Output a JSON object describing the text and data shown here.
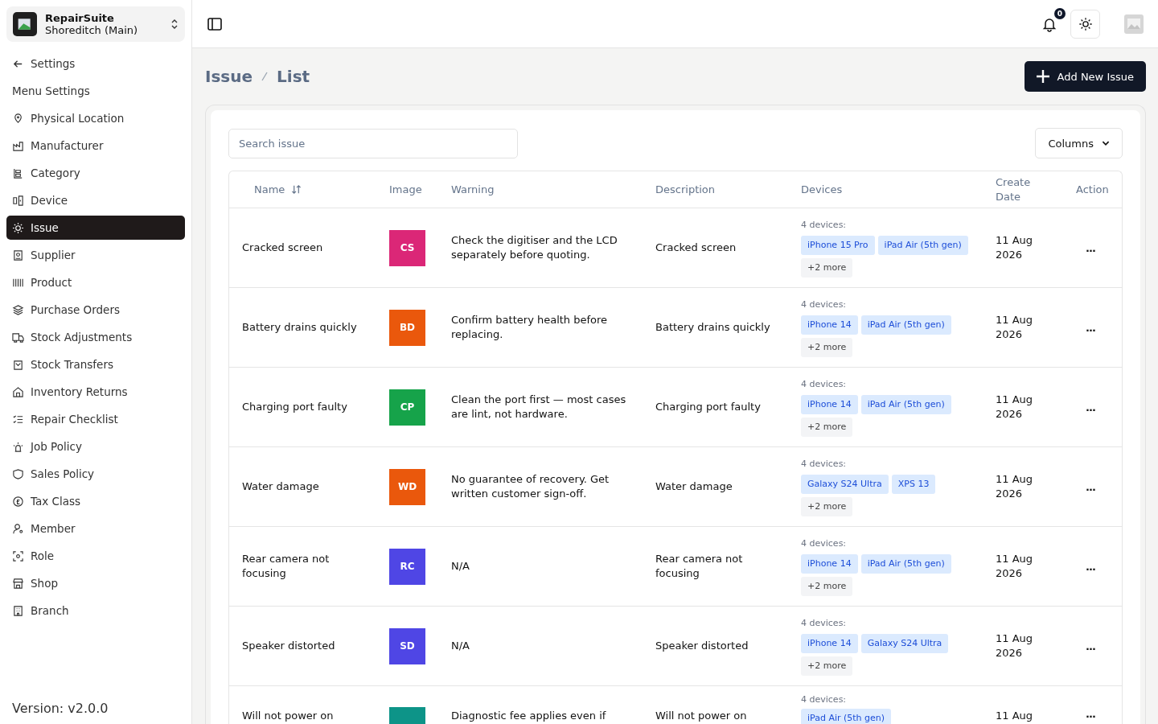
{
  "org": {
    "name": "RepairSuite",
    "branch": "Shoreditch (Main)"
  },
  "sidebar": {
    "back": "Settings",
    "section": "Menu Settings",
    "items": [
      {
        "label": "Physical Location",
        "selected": false
      },
      {
        "label": "Manufacturer",
        "selected": false
      },
      {
        "label": "Category",
        "selected": false
      },
      {
        "label": "Device",
        "selected": false
      },
      {
        "label": "Issue",
        "selected": true
      },
      {
        "label": "Supplier",
        "selected": false
      },
      {
        "label": "Product",
        "selected": false
      },
      {
        "label": "Purchase Orders",
        "selected": false
      },
      {
        "label": "Stock Adjustments",
        "selected": false
      },
      {
        "label": "Stock Transfers",
        "selected": false
      },
      {
        "label": "Inventory Returns",
        "selected": false
      },
      {
        "label": "Repair Checklist",
        "selected": false
      },
      {
        "label": "Job Policy",
        "selected": false
      },
      {
        "label": "Sales Policy",
        "selected": false
      },
      {
        "label": "Tax Class",
        "selected": false
      },
      {
        "label": "Member",
        "selected": false
      },
      {
        "label": "Role",
        "selected": false
      },
      {
        "label": "Shop",
        "selected": false
      },
      {
        "label": "Branch",
        "selected": false
      }
    ],
    "version": "Version: v2.0.0"
  },
  "header": {
    "notifications": "0"
  },
  "breadcrumb": [
    "Issue",
    "List"
  ],
  "add_button": "Add New Issue",
  "search": {
    "placeholder": "Search issue"
  },
  "columns_button": "Columns",
  "table": {
    "columns": [
      "Name",
      "Image",
      "Warning",
      "Description",
      "Devices",
      "Create Date",
      "Action"
    ],
    "rows": [
      {
        "name": "Cracked screen",
        "initials": "CS",
        "color": "#db2777",
        "warning": "Check the digitiser and the LCD separately before quoting.",
        "description": "Cracked screen",
        "device_count": "4 devices:",
        "devices": [
          "iPhone 15 Pro",
          "iPad Air (5th gen)"
        ],
        "more": "+2 more",
        "date": "11 Aug 2026",
        "action": "..."
      },
      {
        "name": "Battery drains quickly",
        "initials": "BD",
        "color": "#ea580c",
        "warning": "Confirm battery health before replacing.",
        "description": "Battery drains quickly",
        "device_count": "4 devices:",
        "devices": [
          "iPhone 14",
          "iPad Air (5th gen)"
        ],
        "more": "+2 more",
        "date": "11 Aug 2026",
        "action": "..."
      },
      {
        "name": "Charging port faulty",
        "initials": "CP",
        "color": "#16a34a",
        "warning": "Clean the port first — most cases are lint, not hardware.",
        "description": "Charging port faulty",
        "device_count": "4 devices:",
        "devices": [
          "iPhone 14",
          "iPad Air (5th gen)"
        ],
        "more": "+2 more",
        "date": "11 Aug 2026",
        "action": "..."
      },
      {
        "name": "Water damage",
        "initials": "WD",
        "color": "#ea580c",
        "warning": "No guarantee of recovery. Get written customer sign-off.",
        "description": "Water damage",
        "device_count": "4 devices:",
        "devices": [
          "Galaxy S24 Ultra",
          "XPS 13"
        ],
        "more": "+2 more",
        "date": "11 Aug 2026",
        "action": "..."
      },
      {
        "name": "Rear camera not focusing",
        "initials": "RC",
        "color": "#4f46e5",
        "warning": "N/A",
        "description": "Rear camera not focusing",
        "device_count": "4 devices:",
        "devices": [
          "iPhone 14",
          "iPad Air (5th gen)"
        ],
        "more": "+2 more",
        "date": "11 Aug 2026",
        "action": "..."
      },
      {
        "name": "Speaker distorted",
        "initials": "SD",
        "color": "#4f46e5",
        "warning": "N/A",
        "description": "Speaker distorted",
        "device_count": "4 devices:",
        "devices": [
          "iPhone 14",
          "Galaxy S24 Ultra"
        ],
        "more": "+2 more",
        "date": "11 Aug 2026",
        "action": "..."
      },
      {
        "name": "Will not power on",
        "color": "#0d9488",
        "warning": "Diagnostic fee applies even if",
        "description": "Will not power on",
        "device_count": "4 devices:",
        "devices": [
          "iPad Air (5th gen)"
        ],
        "date": "11 Aug",
        "action": "..."
      }
    ]
  }
}
